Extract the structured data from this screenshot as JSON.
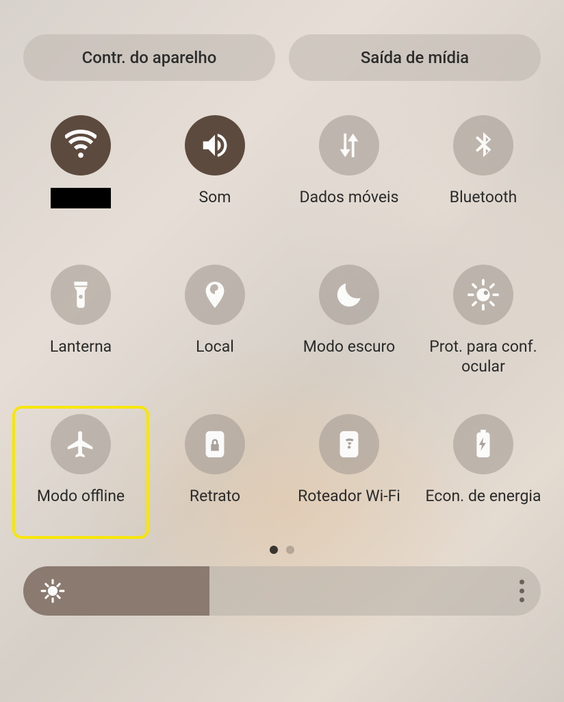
{
  "topbar": {
    "device_control": "Contr. do aparelho",
    "media_output": "Saída de mídia"
  },
  "tiles": [
    {
      "id": "wifi",
      "label": "",
      "icon": "wifi-icon",
      "active": true,
      "highlighted": false,
      "redacted_label": true
    },
    {
      "id": "sound",
      "label": "Som",
      "icon": "sound-icon",
      "active": true,
      "highlighted": false
    },
    {
      "id": "mobiledata",
      "label": "Dados móveis",
      "icon": "data-arrows-icon",
      "active": false,
      "highlighted": false
    },
    {
      "id": "bluetooth",
      "label": "Bluetooth",
      "icon": "bluetooth-icon",
      "active": false,
      "highlighted": false
    },
    {
      "id": "flashlight",
      "label": "Lanterna",
      "icon": "flashlight-icon",
      "active": false,
      "highlighted": false
    },
    {
      "id": "location",
      "label": "Local",
      "icon": "location-icon",
      "active": false,
      "highlighted": false
    },
    {
      "id": "darkmode",
      "label": "Modo escuro",
      "icon": "moon-icon",
      "active": false,
      "highlighted": false
    },
    {
      "id": "eyecomfort",
      "label": "Prot. para conf. ocular",
      "icon": "eye-comfort-icon",
      "active": false,
      "highlighted": false
    },
    {
      "id": "airplane",
      "label": "Modo offline",
      "icon": "airplane-icon",
      "active": false,
      "highlighted": true
    },
    {
      "id": "portrait",
      "label": "Retrato",
      "icon": "portrait-lock-icon",
      "active": false,
      "highlighted": false
    },
    {
      "id": "hotspot",
      "label": "Roteador Wi-Fi",
      "icon": "hotspot-icon",
      "active": false,
      "highlighted": false
    },
    {
      "id": "powersave",
      "label": "Econ. de energia",
      "icon": "battery-save-icon",
      "active": false,
      "highlighted": false
    }
  ],
  "pagination": {
    "pages": 2,
    "current": 1
  },
  "brightness": {
    "percent": 36
  },
  "colors": {
    "active_bg": "#5d4a3e",
    "highlight": "#f7e600"
  }
}
